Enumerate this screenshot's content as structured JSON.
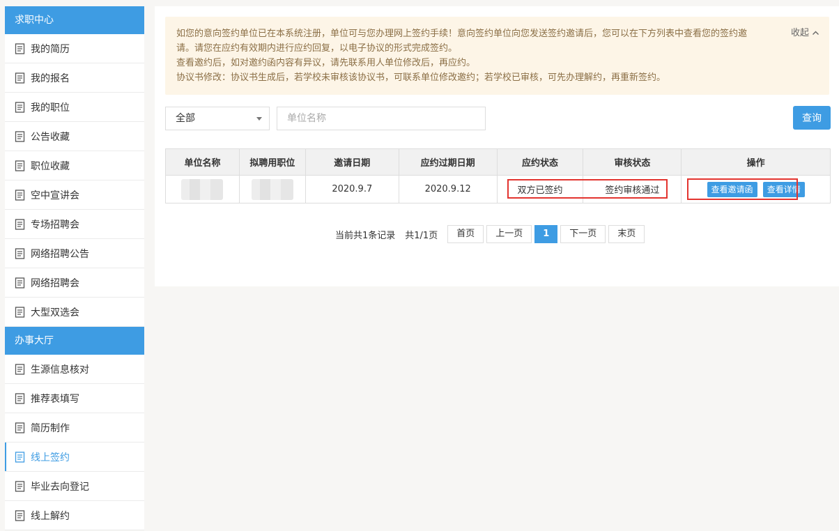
{
  "sidebar": {
    "section1": {
      "title": "求职中心",
      "items": [
        "我的简历",
        "我的报名",
        "我的职位",
        "公告收藏",
        "职位收藏",
        "空中宣讲会",
        "专场招聘会",
        "网络招聘公告",
        "网络招聘会",
        "大型双选会"
      ]
    },
    "section2": {
      "title": "办事大厅",
      "items": [
        "生源信息核对",
        "推荐表填写",
        "简历制作",
        "线上签约",
        "毕业去向登记",
        "线上解约"
      ],
      "active_item": "线上签约"
    }
  },
  "notice": {
    "line1": "如您的意向签约单位已在本系统注册，单位可与您办理网上签约手续！意向签约单位向您发送签约邀请后，您可以在下方列表中查看您的签约邀请。请您在应约有效期内进行应约回复，以电子协议的形式完成签约。",
    "line2": "查看邀约后，如对邀约函内容有异议，请先联系用人单位修改后，再应约。",
    "line3": "协议书修改：协议书生成后，若学校未审核该协议书，可联系单位修改邀约；若学校已审核，可先办理解约，再重新签约。",
    "collapse_label": "收起"
  },
  "filter": {
    "select_value": "全部",
    "search_placeholder": "单位名称",
    "query_label": "查询"
  },
  "table": {
    "headers": [
      "单位名称",
      "拟聘用职位",
      "邀请日期",
      "应约过期日期",
      "应约状态",
      "审核状态",
      "操作"
    ],
    "rows": [
      {
        "invite_date": "2020.9.7",
        "expire_date": "2020.9.12",
        "reply_status": "双方已签约",
        "audit_status": "签约审核通过",
        "action1": "查看邀请函",
        "action2": "查看详情"
      }
    ]
  },
  "pager": {
    "record_text": "当前共1条记录",
    "page_text": "共1/1页",
    "first": "首页",
    "prev": "上一页",
    "current": "1",
    "next": "下一页",
    "last": "末页"
  },
  "colors": {
    "accent": "#3e9ce3",
    "status_green": "#2a8a2a",
    "highlight_red": "#e3342f",
    "notice_bg": "#fdf5e7"
  }
}
